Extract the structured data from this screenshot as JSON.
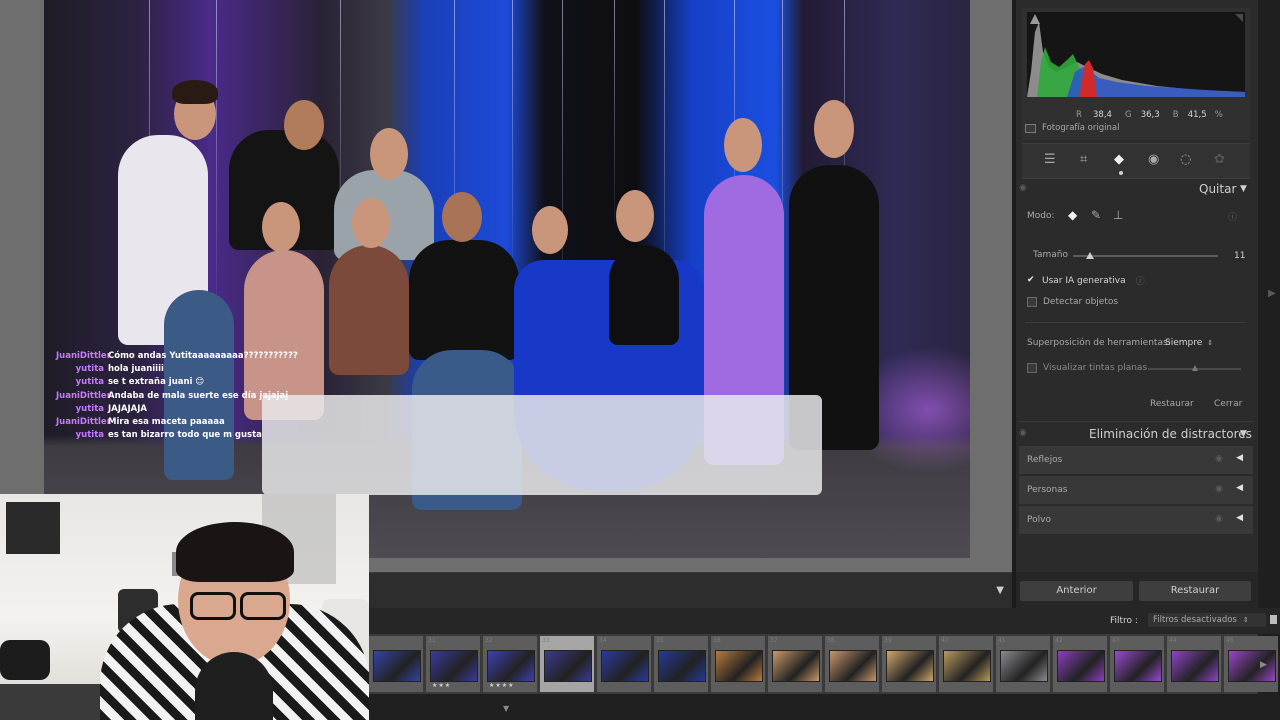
{
  "chat": [
    {
      "user": "JuaniDittler",
      "msg": "Cómo andas Yutitaaaaaaaaa???????????"
    },
    {
      "user": "yutita",
      "msg": "hola juaniiii"
    },
    {
      "user": "yutita",
      "msg": "se t extraña juani 😊"
    },
    {
      "user": "JuaniDittler",
      "msg": "Andaba de mala suerte ese día jajajaj"
    },
    {
      "user": "yutita",
      "msg": "JAJAJAJA"
    },
    {
      "user": "JuaniDittler",
      "msg": "Mira esa maceta paaaaa"
    },
    {
      "user": "yutita",
      "msg": "es tan bizarro todo que m gusta"
    }
  ],
  "histogram": {
    "r_label": "R",
    "r_value": "38,4",
    "g_label": "G",
    "g_value": "36,3",
    "b_label": "B",
    "b_value": "41,5",
    "unit": "%",
    "original_photo_label": "Fotografía original"
  },
  "tools": [
    "sliders-icon",
    "crop-icon",
    "eraser-icon",
    "red-eye-icon",
    "mask-icon",
    "presets-icon"
  ],
  "remove_panel": {
    "title": "Quitar",
    "mode_label": "Modo:",
    "size_label": "Tamaño",
    "size_value": "11",
    "size_fraction": 0.05,
    "use_ai_label": "Usar IA generativa",
    "use_ai_checked": true,
    "detect_objects_label": "Detectar objetos",
    "detect_objects_checked": false,
    "overlay_label": "Superposición de herramientas:",
    "overlay_value": "Siempre",
    "flat_tints_label": "Visualizar tintas planas",
    "reset_label": "Restaurar",
    "close_label": "Cerrar"
  },
  "distractors_panel": {
    "title": "Eliminación de distractores",
    "items": [
      "Reflejos",
      "Personas",
      "Polvo"
    ]
  },
  "footer_buttons": {
    "previous": "Anterior",
    "reset": "Restaurar"
  },
  "filter": {
    "label": "Filtro :",
    "value": "Filtros desactivados"
  },
  "filmstrip": [
    {
      "num": "",
      "stars": "",
      "tone": "#3543a8"
    },
    {
      "num": "31",
      "stars": "★★★",
      "tone": "#3a3aa0"
    },
    {
      "num": "32",
      "stars": "★★★★",
      "tone": "#3f3fb5"
    },
    {
      "num": "33",
      "stars": "",
      "tone": "#3b3a8e",
      "selected": true
    },
    {
      "num": "34",
      "stars": "",
      "tone": "#2a3aa0"
    },
    {
      "num": "35",
      "stars": "",
      "tone": "#243a9a"
    },
    {
      "num": "36",
      "stars": "",
      "tone": "#b77b3a"
    },
    {
      "num": "37",
      "stars": "",
      "tone": "#c89968"
    },
    {
      "num": "38",
      "stars": "",
      "tone": "#c7966b"
    },
    {
      "num": "39",
      "stars": "",
      "tone": "#cfa76b"
    },
    {
      "num": "40",
      "stars": "",
      "tone": "#b99a5a"
    },
    {
      "num": "41",
      "stars": "",
      "tone": "#8a8a92"
    },
    {
      "num": "42",
      "stars": "",
      "tone": "#8a3fc0"
    },
    {
      "num": "43",
      "stars": "",
      "tone": "#9a4ad0"
    },
    {
      "num": "44",
      "stars": "",
      "tone": "#8d45c8"
    },
    {
      "num": "45",
      "stars": "",
      "tone": "#9a46c9"
    }
  ]
}
